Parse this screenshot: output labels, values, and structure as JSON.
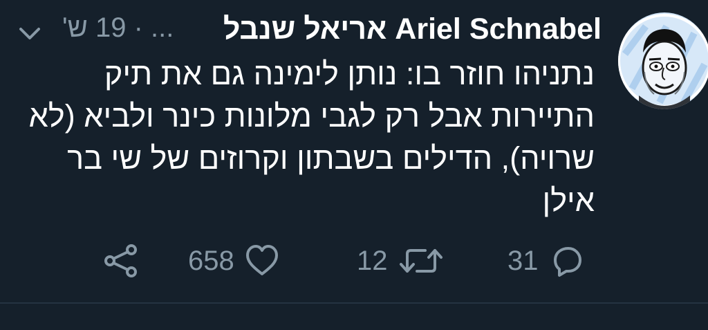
{
  "tweet": {
    "author_name": "Ariel Schnabel אריאל שנבל",
    "handle_ellipsis": "...",
    "separator": "·",
    "time": "19 ש'",
    "lines": [
      "נתניהו חוזר בו: נותן לימינה גם את תיק",
      "התיירות אבל רק לגבי מלונות כינר ולביא (לא",
      "שרויה), הדילים בשבתון וקרוזים של שי בר",
      "אילן"
    ]
  },
  "actions": {
    "replies": "31",
    "retweets": "12",
    "likes": "658"
  },
  "icons": {
    "avatar": "avatar-illustration",
    "caret": "chevron-down-icon",
    "reply": "reply-icon",
    "retweet": "retweet-icon",
    "like": "heart-icon",
    "share": "share-icon"
  },
  "colors": {
    "background": "#15202b",
    "text": "#ffffff",
    "muted": "#8899a6"
  }
}
